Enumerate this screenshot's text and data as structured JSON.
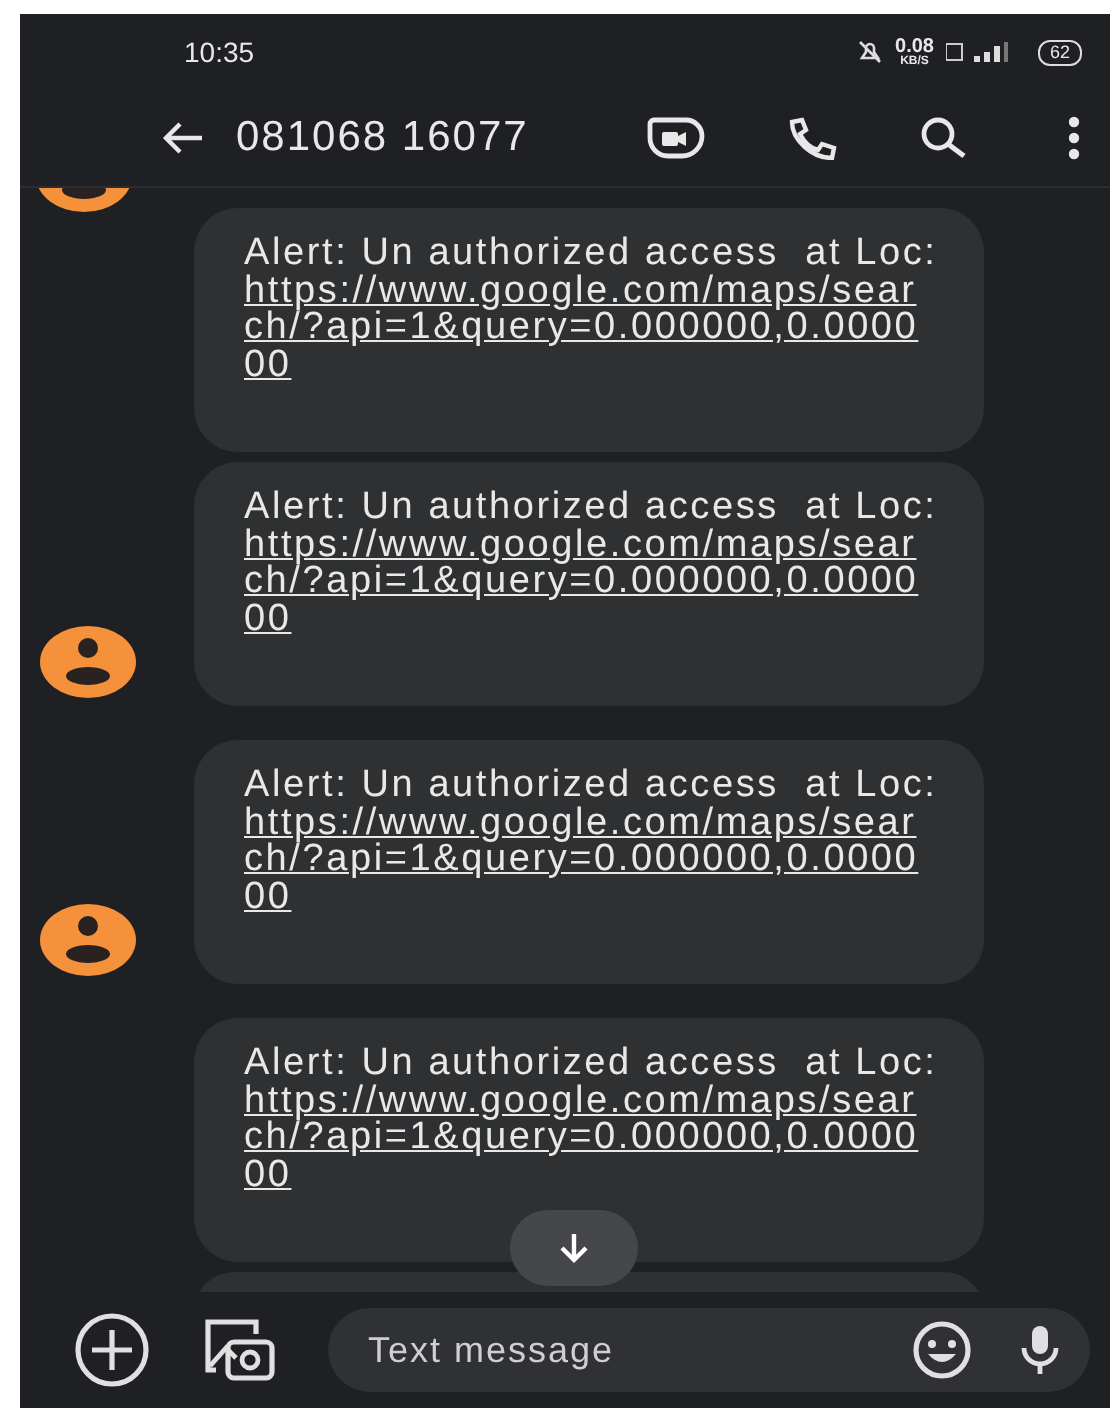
{
  "status_bar": {
    "time": "10:35",
    "speed": "0.08",
    "speed_unit": "KB/S",
    "battery": "62"
  },
  "header": {
    "title": "081068 16077"
  },
  "messages": [
    {
      "text": "Alert: Un authorized access  at Loc:",
      "link": "https://www.google.com/maps/search/?api=1&query=0.000000,0.000000",
      "avatar": false
    },
    {
      "text": "Alert: Un authorized access  at Loc:",
      "link": "https://www.google.com/maps/search/?api=1&query=0.000000,0.000000",
      "avatar": true
    },
    {
      "text": "Alert: Un authorized access  at Loc:",
      "link": "https://www.google.com/maps/search/?api=1&query=0.000000,0.000000",
      "avatar": true
    },
    {
      "text": "Alert: Un authorized access  at Loc:",
      "link": "https://www.google.com/maps/search/?api=1&query=0.000000,0.000000",
      "avatar": false
    }
  ],
  "composer": {
    "placeholder": "Text message"
  }
}
